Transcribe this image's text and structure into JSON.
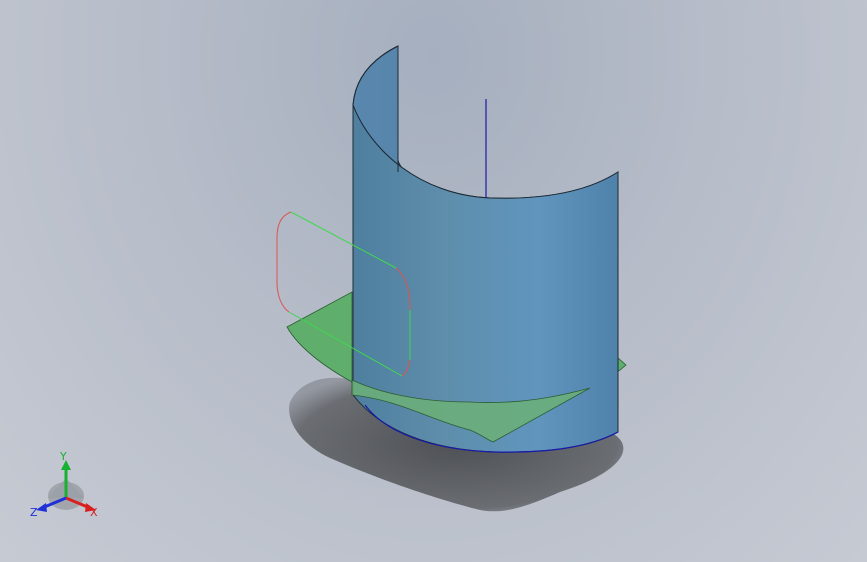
{
  "viewport": {
    "background_top": "#a5afbf",
    "background_bottom": "#c6cad3"
  },
  "model": {
    "surface_color": "#5a8fb5",
    "surface_edge": "#1e2a36",
    "plane_color": "#5fae6c",
    "sketch_line_color": "#3fd84f",
    "sketch_arc_color": "#e0524f",
    "axis_color": "#1a1aa8",
    "shadow_color": "#55585d"
  },
  "triad": {
    "x_label": "X",
    "y_label": "Y",
    "z_label": "Z",
    "x_color": "#d82020",
    "y_color": "#18b030",
    "z_color": "#2030d8"
  }
}
